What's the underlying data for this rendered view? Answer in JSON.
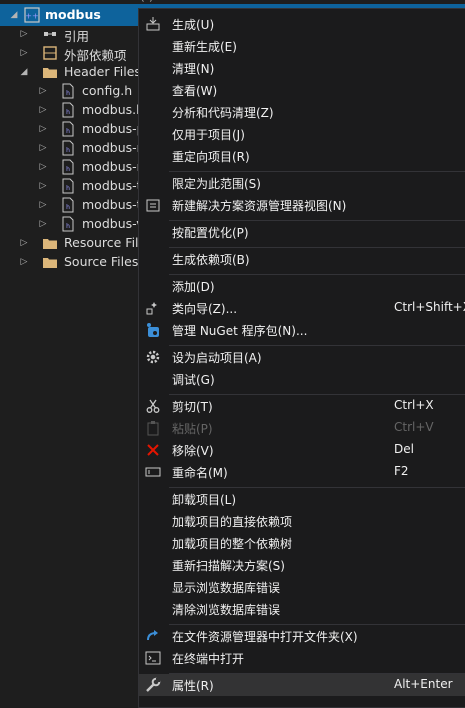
{
  "tree": {
    "project_name": "modbus",
    "top_partial_text": "( )",
    "items": [
      {
        "label": "引用"
      },
      {
        "label": "外部依赖项"
      },
      {
        "label": "Header Files"
      },
      {
        "label": "config.h"
      },
      {
        "label": "modbus.h"
      },
      {
        "label": "modbus-p"
      },
      {
        "label": "modbus-r"
      },
      {
        "label": "modbus-r"
      },
      {
        "label": "modbus-t"
      },
      {
        "label": "modbus-t"
      },
      {
        "label": "modbus-v"
      },
      {
        "label": "Resource File"
      },
      {
        "label": "Source Files"
      }
    ]
  },
  "menu": {
    "items": [
      {
        "label": "生成(U)",
        "shortcut": ""
      },
      {
        "label": "重新生成(E)",
        "shortcut": ""
      },
      {
        "label": "清理(N)",
        "shortcut": ""
      },
      {
        "label": "查看(W)",
        "shortcut": ""
      },
      {
        "label": "分析和代码清理(Z)",
        "shortcut": ""
      },
      {
        "label": "仅用于项目(J)",
        "shortcut": ""
      },
      {
        "label": "重定向项目(R)",
        "shortcut": ""
      },
      {
        "label": "限定为此范围(S)",
        "shortcut": ""
      },
      {
        "label": "新建解决方案资源管理器视图(N)",
        "shortcut": ""
      },
      {
        "label": "按配置优化(P)",
        "shortcut": ""
      },
      {
        "label": "生成依赖项(B)",
        "shortcut": ""
      },
      {
        "label": "添加(D)",
        "shortcut": ""
      },
      {
        "label": "类向导(Z)...",
        "shortcut": "Ctrl+Shift+X"
      },
      {
        "label": "管理 NuGet 程序包(N)...",
        "shortcut": ""
      },
      {
        "label": "设为启动项目(A)",
        "shortcut": ""
      },
      {
        "label": "调试(G)",
        "shortcut": ""
      },
      {
        "label": "剪切(T)",
        "shortcut": "Ctrl+X"
      },
      {
        "label": "粘贴(P)",
        "shortcut": "Ctrl+V"
      },
      {
        "label": "移除(V)",
        "shortcut": "Del"
      },
      {
        "label": "重命名(M)",
        "shortcut": "F2"
      },
      {
        "label": "卸载项目(L)",
        "shortcut": ""
      },
      {
        "label": "加载项目的直接依赖项",
        "shortcut": ""
      },
      {
        "label": "加载项目的整个依赖树",
        "shortcut": ""
      },
      {
        "label": "重新扫描解决方案(S)",
        "shortcut": ""
      },
      {
        "label": "显示浏览数据库错误",
        "shortcut": ""
      },
      {
        "label": "清除浏览数据库错误",
        "shortcut": ""
      },
      {
        "label": "在文件资源管理器中打开文件夹(X)",
        "shortcut": ""
      },
      {
        "label": "在终端中打开",
        "shortcut": ""
      },
      {
        "label": "属性(R)",
        "shortcut": "Alt+Enter"
      }
    ]
  },
  "colors": {
    "background": "#1e1e1e",
    "selection": "#0e639c",
    "menu_background": "#1b1b1c",
    "menu_hover": "#333334",
    "remove_icon": "#e51400",
    "nuget_icon": "#3c8fd8",
    "folder_icon": "#dcb67a"
  }
}
